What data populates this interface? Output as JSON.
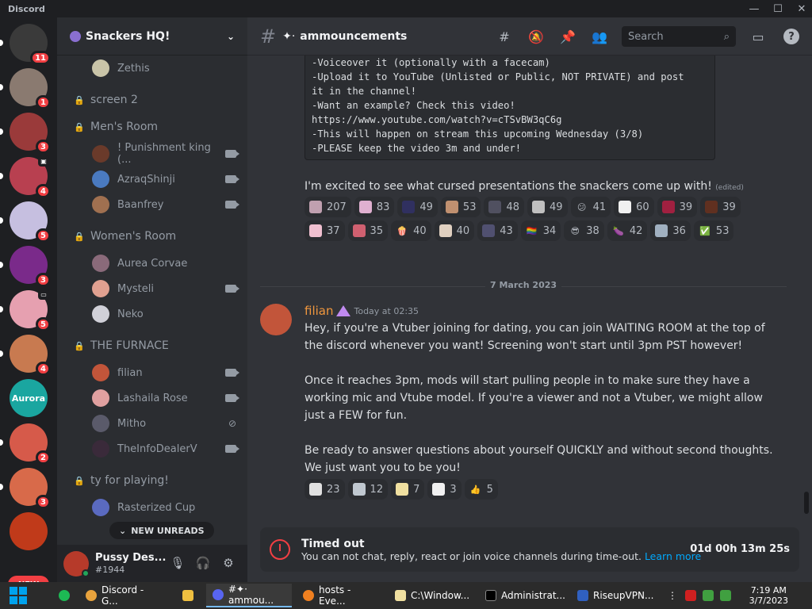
{
  "window": {
    "title": "Discord"
  },
  "guilds": [
    {
      "badge": "11",
      "color": "#3a3a3a"
    },
    {
      "badge": "1",
      "color": "#8a7a70"
    },
    {
      "badge": "3",
      "color": "#9a3a3a"
    },
    {
      "badge": "4",
      "color": "#b84050"
    },
    {
      "badge": "5",
      "color": "#c6bfe0"
    },
    {
      "badge": "3",
      "color": "#7a2a8a"
    },
    {
      "badge": "5",
      "color": "#e6a0b0"
    },
    {
      "badge": "4",
      "color": "#c87a50"
    },
    {
      "label": "Aurora",
      "color": "#1aa6a0"
    },
    {
      "badge": "2",
      "color": "#d65a4a"
    },
    {
      "badge": "3",
      "color": "#d86a4a"
    },
    {
      "badge": "",
      "color": "#c03a1a"
    }
  ],
  "new_pill": "NEW",
  "server": {
    "name": "Snackers HQ!"
  },
  "sidebar": {
    "top_member": "Zethis",
    "channels": [
      {
        "label": "screen 2"
      },
      {
        "label": "Men's Room",
        "members": [
          "! Punishment king (...",
          "AzraqShinji",
          "Baanfrey"
        ]
      },
      {
        "label": "Women's Room",
        "members": [
          "Aurea Corvae",
          "Mysteli",
          "Neko"
        ]
      },
      {
        "label": "THE FURNACE",
        "members": [
          "filian",
          "Lashaila Rose",
          "Mitho",
          "TheInfoDealerV"
        ]
      },
      {
        "label": "ty for playing!",
        "members": [
          "Rasterized Cup"
        ]
      }
    ],
    "new_unreads": "NEW UNREADS"
  },
  "user": {
    "name": "Pussy Des...",
    "tag": "#1944"
  },
  "header": {
    "channel": "ammouncements",
    "search_placeholder": "Search"
  },
  "messages": {
    "code_lines": [
      "-Voiceover it (optionally with a facecam)",
      "-Upload it to YouTube (Unlisted or Public, NOT PRIVATE) and post",
      "it in the channel!",
      "-Want an example? Check this video!",
      "https://www.youtube.com/watch?v=cTSvBW3qC6g",
      "-This will happen on stream this upcoming Wednesday (3/8)",
      "-PLEASE keep the video 3m and under!"
    ],
    "excited": "I'm excited to see what cursed presentations the snackers come up with!",
    "edited": "(edited)",
    "reactions1": [
      "207",
      "83",
      "49",
      "53",
      "48",
      "49",
      "41",
      "60",
      "39",
      "39",
      "37",
      "35",
      "40",
      "40",
      "43",
      "34",
      "38",
      "42",
      "36",
      "53"
    ],
    "reaction1_emojis": [
      "",
      "",
      "",
      "",
      "",
      "",
      "😕",
      "",
      "",
      "",
      "",
      "",
      "🍿",
      "",
      "",
      "🏳️‍🌈",
      "😎",
      "🍆",
      "",
      "✅"
    ],
    "date_divider": "7 March 2023",
    "author": "filian",
    "timestamp": "Today at 02:35",
    "p1a": "Hey, if you're a Vtuber joining for dating, you can join WAITING ROOM at the top of",
    "p1b": "the discord whenever you want! Screening won't start until 3pm PST however!",
    "p2a": "Once it reaches 3pm, mods will start pulling people in to make sure they have a",
    "p2b": "working mic and Vtube model. If you're a viewer and not a Vtuber, we might allow",
    "p2c": "just a FEW for fun.",
    "p3a": "Be ready to answer questions about yourself QUICKLY and without second thoughts.",
    "p3b": "We just want you to be you!",
    "reactions2": [
      "23",
      "12",
      "7",
      "3",
      "5"
    ],
    "reaction2_emojis": [
      "",
      "",
      "",
      "",
      "👍"
    ]
  },
  "timeout": {
    "title": "Timed out",
    "desc": "You can not chat, reply, react or join voice channels during time-out.",
    "link": "Learn more",
    "remaining": "01d 00h 13m 25s"
  },
  "taskbar": {
    "items": [
      "Discord - G...",
      "#✦· ammou...",
      "hosts - Eve...",
      "C:\\Window...",
      "Administrat...",
      "RiseupVPN..."
    ],
    "time": "7:19 AM",
    "date": "3/7/2023"
  }
}
